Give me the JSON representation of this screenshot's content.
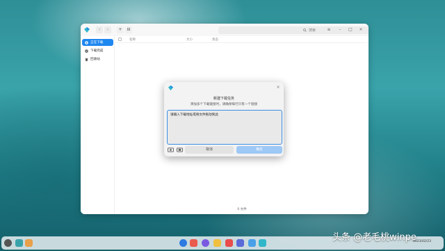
{
  "window": {
    "search_placeholder": "搜索",
    "nav_back": "‹",
    "nav_forward": "›",
    "add_button": "+",
    "controls": {
      "menu": "≡",
      "minimize": "–",
      "maximize": "□",
      "close": "×"
    }
  },
  "sidebar": {
    "items": [
      {
        "label": "正在下载",
        "icon": "download-icon",
        "active": true
      },
      {
        "label": "下载完成",
        "icon": "check-circle-icon",
        "active": false
      },
      {
        "label": "回收站",
        "icon": "trash-icon",
        "active": false
      }
    ]
  },
  "table": {
    "headers": [
      "名称",
      "大小",
      "状态"
    ]
  },
  "status_bar": {
    "text": "0 文件"
  },
  "dialog": {
    "title": "新建下载任务",
    "hint": "添加多个下载链接时，请确保每行只有一个链接",
    "textarea_placeholder": "请输入下载地址或将文件拖动到此",
    "close": "×",
    "cancel_label": "取消",
    "confirm_label": "确定"
  },
  "taskbar": {
    "items": [
      "launcher-icon",
      "multitask-icon",
      "file-manager-icon",
      "browser-icon",
      "music-icon",
      "store-icon",
      "photos-icon",
      "calendar-icon",
      "settings-icon",
      "downloader-icon"
    ],
    "time": "2023/02/23"
  },
  "watermark": "头条 @老毛桃winpe",
  "colors": {
    "accent": "#1f87f0",
    "confirm_disabled": "#9ec8f5",
    "focus_border": "#3a8ee6"
  }
}
